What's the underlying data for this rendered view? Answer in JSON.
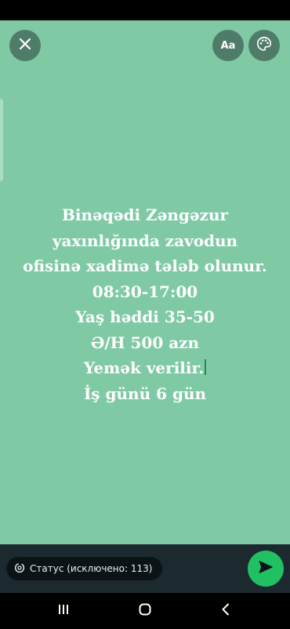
{
  "toolbar": {
    "close_icon": "close-icon",
    "font_label": "Aa",
    "palette_icon": "palette-icon"
  },
  "status": {
    "background_color": "#7fcaa5",
    "text_color": "#ffffff",
    "lines": [
      "Binəqədi Zəngəzur",
      "yaxınlığında zavodun",
      "ofisinə xadimə tələb olunur.",
      "08:30-17:00",
      "Yaş həddi 35-50",
      "Ə/H 500 azn",
      "Yemək verilir.",
      "İş günü 6 gün"
    ]
  },
  "composer": {
    "audience_icon": "privacy-icon",
    "audience_label": "Статус (исключено: 113)",
    "send_icon": "send-icon",
    "send_color": "#21c063"
  },
  "navigation": {
    "recents_icon": "recents-icon",
    "home_icon": "home-icon",
    "back_icon": "back-icon"
  }
}
